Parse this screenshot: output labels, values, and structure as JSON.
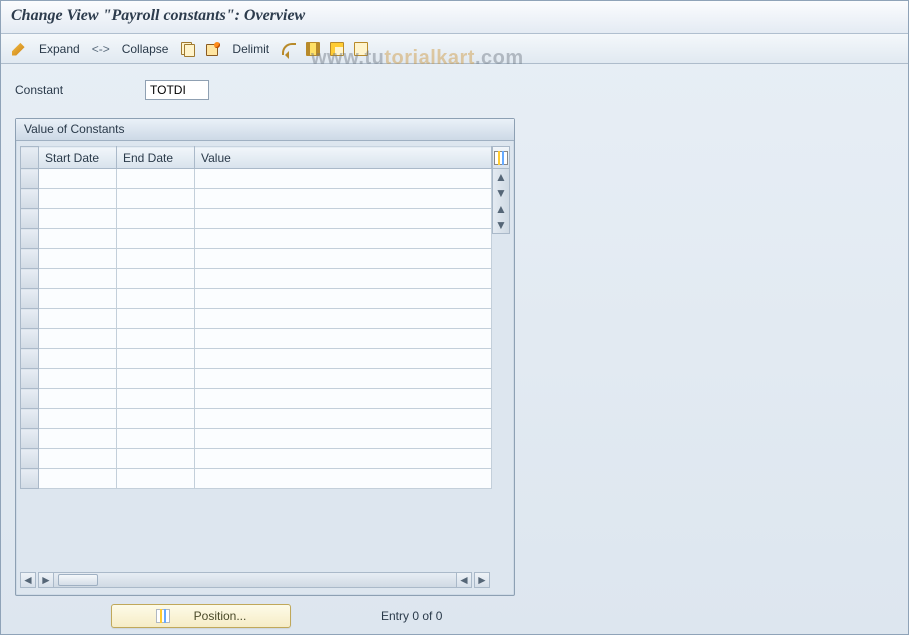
{
  "title": "Change View \"Payroll constants\": Overview",
  "toolbar": {
    "expand": "Expand",
    "sep": "<->",
    "collapse": "Collapse",
    "delimit": "Delimit"
  },
  "field": {
    "label": "Constant",
    "value": "TOTDI"
  },
  "grid": {
    "title": "Value of Constants",
    "columns": {
      "start": "Start Date",
      "end": "End Date",
      "value": "Value"
    },
    "row_count": 16
  },
  "footer": {
    "position": "Position...",
    "entry": "Entry 0 of 0"
  },
  "watermark": {
    "a": "www.tu",
    "b": "torialkart",
    "c": ".com"
  }
}
